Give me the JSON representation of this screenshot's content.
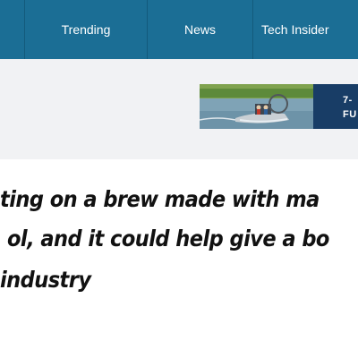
{
  "nav": {
    "items": [
      {
        "label": "Trending"
      },
      {
        "label": "News"
      },
      {
        "label": "Tech Insider"
      }
    ]
  },
  "ad": {
    "line1": "7-",
    "line2": "FU"
  },
  "article": {
    "headline_lines": [
      "ting on a brew made with ma",
      "ol, and it could help give a bo",
      "industry"
    ]
  },
  "colors": {
    "nav_background": "#1b6e95",
    "ad_band_background": "#f1f2f4",
    "ad_panel": "#183d66",
    "headline_text": "#111111"
  }
}
